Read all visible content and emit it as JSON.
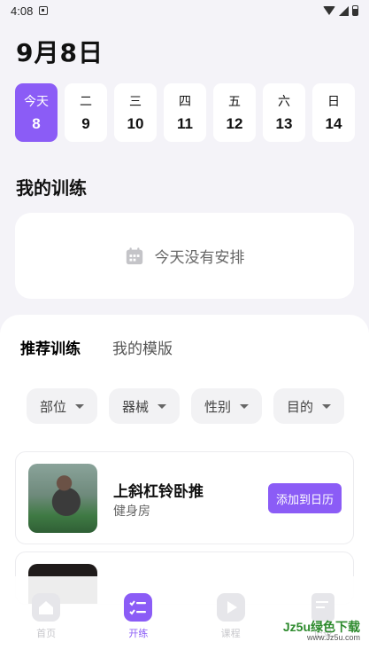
{
  "status_bar": {
    "time": "4:08"
  },
  "header": {
    "date": "9月8日"
  },
  "week": [
    {
      "name": "今天",
      "num": "8",
      "active": true
    },
    {
      "name": "二",
      "num": "9"
    },
    {
      "name": "三",
      "num": "10"
    },
    {
      "name": "四",
      "num": "11"
    },
    {
      "name": "五",
      "num": "12"
    },
    {
      "name": "六",
      "num": "13"
    },
    {
      "name": "日",
      "num": "14"
    }
  ],
  "my_training": {
    "title": "我的训练",
    "empty_text": "今天没有安排"
  },
  "tabs": [
    {
      "label": "推荐训练",
      "active": true
    },
    {
      "label": "我的模版"
    }
  ],
  "filters": [
    "部位",
    "器械",
    "性别",
    "目的"
  ],
  "exercises": [
    {
      "name": "上斜杠铃卧推",
      "place": "健身房",
      "add_label": "添加到日历"
    }
  ],
  "nav": [
    {
      "label": "首页",
      "icon": "home-icon"
    },
    {
      "label": "开练",
      "icon": "checklist-icon",
      "active": true
    },
    {
      "label": "课程",
      "icon": "play-icon"
    },
    {
      "label": "记录",
      "icon": "document-icon"
    }
  ],
  "watermark": {
    "line1": "Jz5u绿色下载",
    "line2": "www.Jz5u.com"
  },
  "colors": {
    "accent": "#8b5cf6",
    "background": "#f4f3f8"
  }
}
